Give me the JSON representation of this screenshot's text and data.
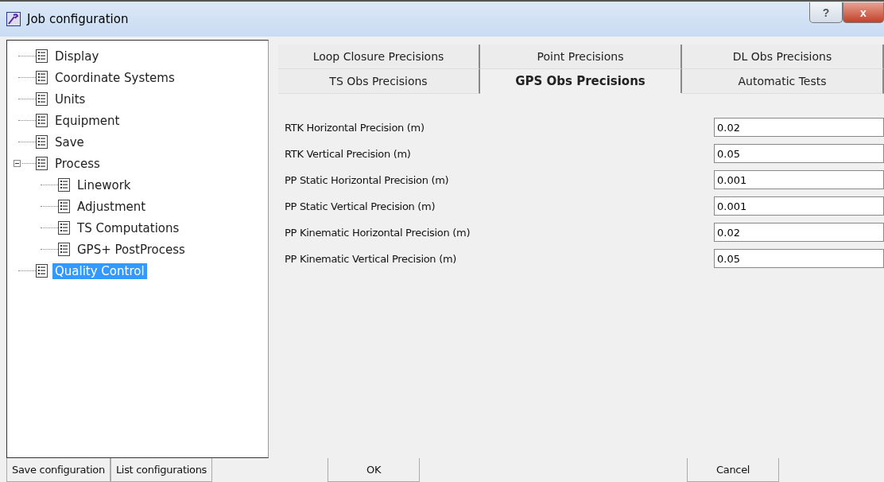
{
  "window": {
    "title": "Job configuration",
    "buttons": [
      "?",
      "x"
    ]
  },
  "tree": [
    {
      "label": "Display",
      "selected": false
    },
    {
      "label": "Coordinate Systems",
      "selected": false
    },
    {
      "label": "Units",
      "selected": false
    },
    {
      "label": "Equipment",
      "selected": false
    },
    {
      "label": "Save",
      "selected": false
    },
    {
      "label": "Process",
      "selected": false,
      "expanded": true,
      "children": [
        {
          "label": "Linework",
          "selected": false
        },
        {
          "label": "Adjustment",
          "selected": false
        },
        {
          "label": "TS Computations",
          "selected": false
        },
        {
          "label": "GPS+ PostProcess",
          "selected": false
        }
      ]
    },
    {
      "label": "Quality Control",
      "selected": true
    }
  ],
  "tab_rows": [
    [
      {
        "label": "Loop Closure Precisions",
        "selected": false
      },
      {
        "label": "Point Precisions",
        "selected": false
      },
      {
        "label": "DL Obs Precisions",
        "selected": false
      }
    ],
    [
      {
        "label": "TS Obs Precisions",
        "selected": false
      },
      {
        "label": "GPS Obs Precisions",
        "selected": true
      },
      {
        "label": "Automatic Tests",
        "selected": false
      }
    ]
  ],
  "fields": [
    {
      "label": "RTK Horizontal Precision (m)",
      "value": "0.02"
    },
    {
      "label": "RTK Vertical Precision (m)",
      "value": "0.05"
    },
    {
      "label": "PP Static Horizontal Precision (m)",
      "value": "0.001"
    },
    {
      "label": "PP Static Vertical Precision (m)",
      "value": "0.001"
    },
    {
      "label": "PP Kinematic Horizontal Precision (m)",
      "value": "0.02"
    },
    {
      "label": "PP Kinematic Vertical Precision (m)",
      "value": "0.05"
    }
  ],
  "left_buttons": [
    "Save configuration",
    "List configurations"
  ],
  "ok_button": "OK",
  "cancel_button": "Cancel"
}
